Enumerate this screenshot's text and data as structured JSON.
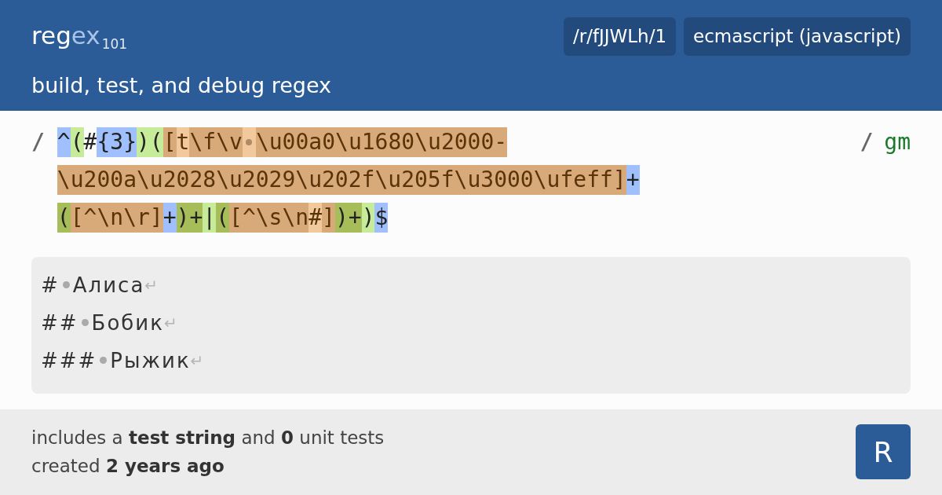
{
  "header": {
    "logo": [
      {
        "text": "reg",
        "kind": "main"
      },
      {
        "text": "ex",
        "kind": "light"
      },
      {
        "text": "101",
        "kind": "sub"
      }
    ],
    "tagline": "build, test, and debug regex",
    "badges": [
      "/r/fJJWLh/1",
      "ecmascript (javascript)"
    ]
  },
  "regex": {
    "open_delimiter": "/",
    "close_delimiter": "/",
    "flags": "gm",
    "lines": [
      [
        {
          "text": "^",
          "kind": "quantifier"
        },
        {
          "text": "(",
          "kind": "group"
        },
        {
          "text": "#",
          "kind": "literal"
        },
        {
          "text": "{3}",
          "kind": "quantifier"
        },
        {
          "text": ")(",
          "kind": "group"
        },
        {
          "text": "[",
          "kind": "class"
        },
        {
          "text": "t",
          "kind": "class-literal"
        },
        {
          "text": "\\f\\v",
          "kind": "class"
        },
        {
          "kind": "space"
        },
        {
          "text": "\\u00a0\\u1680\\u2000-",
          "kind": "class"
        }
      ],
      [
        {
          "text": "\\u200a\\u2028\\u2029\\u202f\\u205f\\u3000\\ufeff]",
          "kind": "class"
        },
        {
          "text": "+",
          "kind": "quantifier"
        }
      ],
      [
        {
          "text": "(",
          "kind": "subgroup"
        },
        {
          "text": "[^\\n\\r]",
          "kind": "class"
        },
        {
          "text": "+",
          "kind": "quantifier"
        },
        {
          "text": ")+",
          "kind": "subgroup"
        },
        {
          "text": "|",
          "kind": "group"
        },
        {
          "text": "(",
          "kind": "subgroup"
        },
        {
          "text": "[^\\s\\n",
          "kind": "class"
        },
        {
          "text": "#",
          "kind": "class-literal"
        },
        {
          "text": "]",
          "kind": "class"
        },
        {
          "text": ")+",
          "kind": "subgroup"
        },
        {
          "text": ")",
          "kind": "group"
        },
        {
          "text": "$",
          "kind": "quantifier"
        }
      ]
    ]
  },
  "test_string": {
    "lines": [
      {
        "prefix": "#",
        "text": "Алиса",
        "end": "↵"
      },
      {
        "prefix": "##",
        "text": "Бобик",
        "end": "↵"
      },
      {
        "prefix": "###",
        "text": "Рыжик",
        "end": "↵"
      }
    ]
  },
  "footer": {
    "lines": [
      "includes a **test string** and **0** unit tests",
      "created **2 years ago**"
    ],
    "avatar": "R"
  }
}
